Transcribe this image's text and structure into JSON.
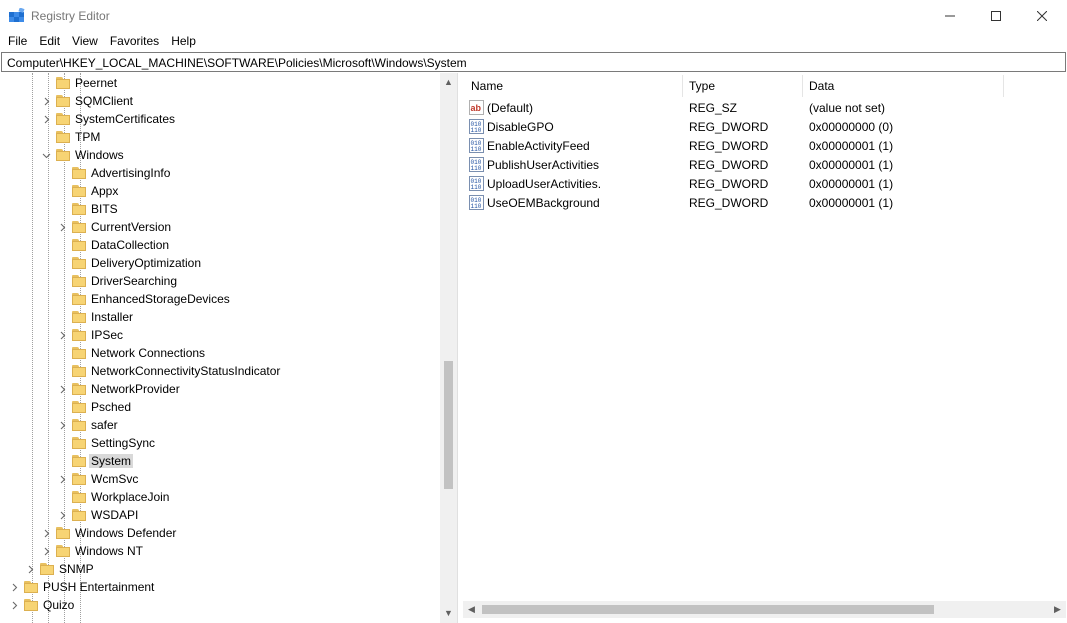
{
  "window": {
    "title": "Registry Editor",
    "app_icon": "registry-cubes-icon",
    "controls": {
      "minimize": "—",
      "maximize": "☐",
      "close": "✕"
    }
  },
  "menu": [
    "File",
    "Edit",
    "View",
    "Favorites",
    "Help"
  ],
  "address": "Computer\\HKEY_LOCAL_MACHINE\\SOFTWARE\\Policies\\Microsoft\\Windows\\System",
  "colors": {
    "folder": "#f7d474",
    "selection": "#d9d9d9",
    "scrollbar_thumb": "#c2c2c2"
  },
  "tree": [
    {
      "label": "Peernet",
      "depth": 3,
      "expander": "none"
    },
    {
      "label": "SQMClient",
      "depth": 3,
      "expander": "collapsed"
    },
    {
      "label": "SystemCertificates",
      "depth": 3,
      "expander": "collapsed"
    },
    {
      "label": "TPM",
      "depth": 3,
      "expander": "none"
    },
    {
      "label": "Windows",
      "depth": 3,
      "expander": "expanded"
    },
    {
      "label": "AdvertisingInfo",
      "depth": 4,
      "expander": "none"
    },
    {
      "label": "Appx",
      "depth": 4,
      "expander": "none"
    },
    {
      "label": "BITS",
      "depth": 4,
      "expander": "none"
    },
    {
      "label": "CurrentVersion",
      "depth": 4,
      "expander": "collapsed"
    },
    {
      "label": "DataCollection",
      "depth": 4,
      "expander": "none"
    },
    {
      "label": "DeliveryOptimization",
      "depth": 4,
      "expander": "none"
    },
    {
      "label": "DriverSearching",
      "depth": 4,
      "expander": "none"
    },
    {
      "label": "EnhancedStorageDevices",
      "depth": 4,
      "expander": "none"
    },
    {
      "label": "Installer",
      "depth": 4,
      "expander": "none"
    },
    {
      "label": "IPSec",
      "depth": 4,
      "expander": "collapsed"
    },
    {
      "label": "Network Connections",
      "depth": 4,
      "expander": "none"
    },
    {
      "label": "NetworkConnectivityStatusIndicator",
      "depth": 4,
      "expander": "none"
    },
    {
      "label": "NetworkProvider",
      "depth": 4,
      "expander": "collapsed"
    },
    {
      "label": "Psched",
      "depth": 4,
      "expander": "none"
    },
    {
      "label": "safer",
      "depth": 4,
      "expander": "collapsed"
    },
    {
      "label": "SettingSync",
      "depth": 4,
      "expander": "none"
    },
    {
      "label": "System",
      "depth": 4,
      "expander": "none",
      "selected": true
    },
    {
      "label": "WcmSvc",
      "depth": 4,
      "expander": "collapsed"
    },
    {
      "label": "WorkplaceJoin",
      "depth": 4,
      "expander": "none"
    },
    {
      "label": "WSDAPI",
      "depth": 4,
      "expander": "collapsed"
    },
    {
      "label": "Windows Defender",
      "depth": 3,
      "expander": "collapsed"
    },
    {
      "label": "Windows NT",
      "depth": 3,
      "expander": "collapsed"
    },
    {
      "label": "SNMP",
      "depth": 2,
      "expander": "collapsed"
    },
    {
      "label": "PUSH Entertainment",
      "depth": 1,
      "expander": "collapsed"
    },
    {
      "label": "Quizo",
      "depth": 1,
      "expander": "collapsed"
    }
  ],
  "values": {
    "columns": {
      "name": "Name",
      "type": "Type",
      "data": "Data"
    },
    "rows": [
      {
        "name": "(Default)",
        "type": "REG_SZ",
        "data": "(value not set)",
        "icon": "string-value-icon"
      },
      {
        "name": "DisableGPO",
        "type": "REG_DWORD",
        "data": "0x00000000 (0)",
        "icon": "binary-value-icon"
      },
      {
        "name": "EnableActivityFeed",
        "type": "REG_DWORD",
        "data": "0x00000001 (1)",
        "icon": "binary-value-icon"
      },
      {
        "name": "PublishUserActivities",
        "type": "REG_DWORD",
        "data": "0x00000001 (1)",
        "icon": "binary-value-icon"
      },
      {
        "name": "UploadUserActivities.",
        "type": "REG_DWORD",
        "data": "0x00000001 (1)",
        "icon": "binary-value-icon"
      },
      {
        "name": "UseOEMBackground",
        "type": "REG_DWORD",
        "data": "0x00000001 (1)",
        "icon": "binary-value-icon"
      }
    ]
  }
}
